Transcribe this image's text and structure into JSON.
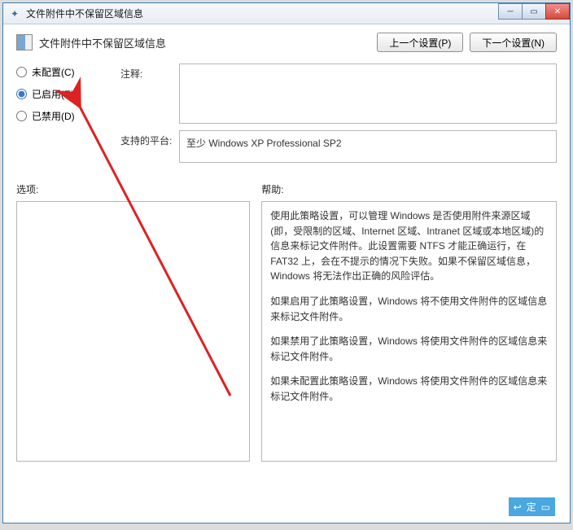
{
  "window": {
    "title": "文件附件中不保留区域信息"
  },
  "header": {
    "policy_title": "文件附件中不保留区域信息",
    "prev_btn": "上一个设置(P)",
    "next_btn": "下一个设置(N)"
  },
  "radios": {
    "not_configured": "未配置(C)",
    "enabled": "已启用(E)",
    "disabled": "已禁用(D)"
  },
  "meta": {
    "comment_label": "注释:",
    "comment_value": "",
    "supported_label": "支持的平台:",
    "supported_value": "至少 Windows XP Professional SP2"
  },
  "columns": {
    "options_label": "选项:",
    "help_label": "帮助:"
  },
  "help": {
    "p1": "使用此策略设置，可以管理 Windows 是否使用附件来源区域(即，受限制的区域、Internet 区域、Intranet 区域或本地区域)的信息来标记文件附件。此设置需要 NTFS 才能正确运行，在 FAT32 上，会在不提示的情况下失败。如果不保留区域信息，Windows 将无法作出正确的风险评估。",
    "p2": "如果启用了此策略设置，Windows 将不使用文件附件的区域信息来标记文件附件。",
    "p3": "如果禁用了此策略设置，Windows 将使用文件附件的区域信息来标记文件附件。",
    "p4": "如果未配置此策略设置，Windows 将使用文件附件的区域信息来标记文件附件。"
  },
  "footer": {
    "ok": "定"
  }
}
